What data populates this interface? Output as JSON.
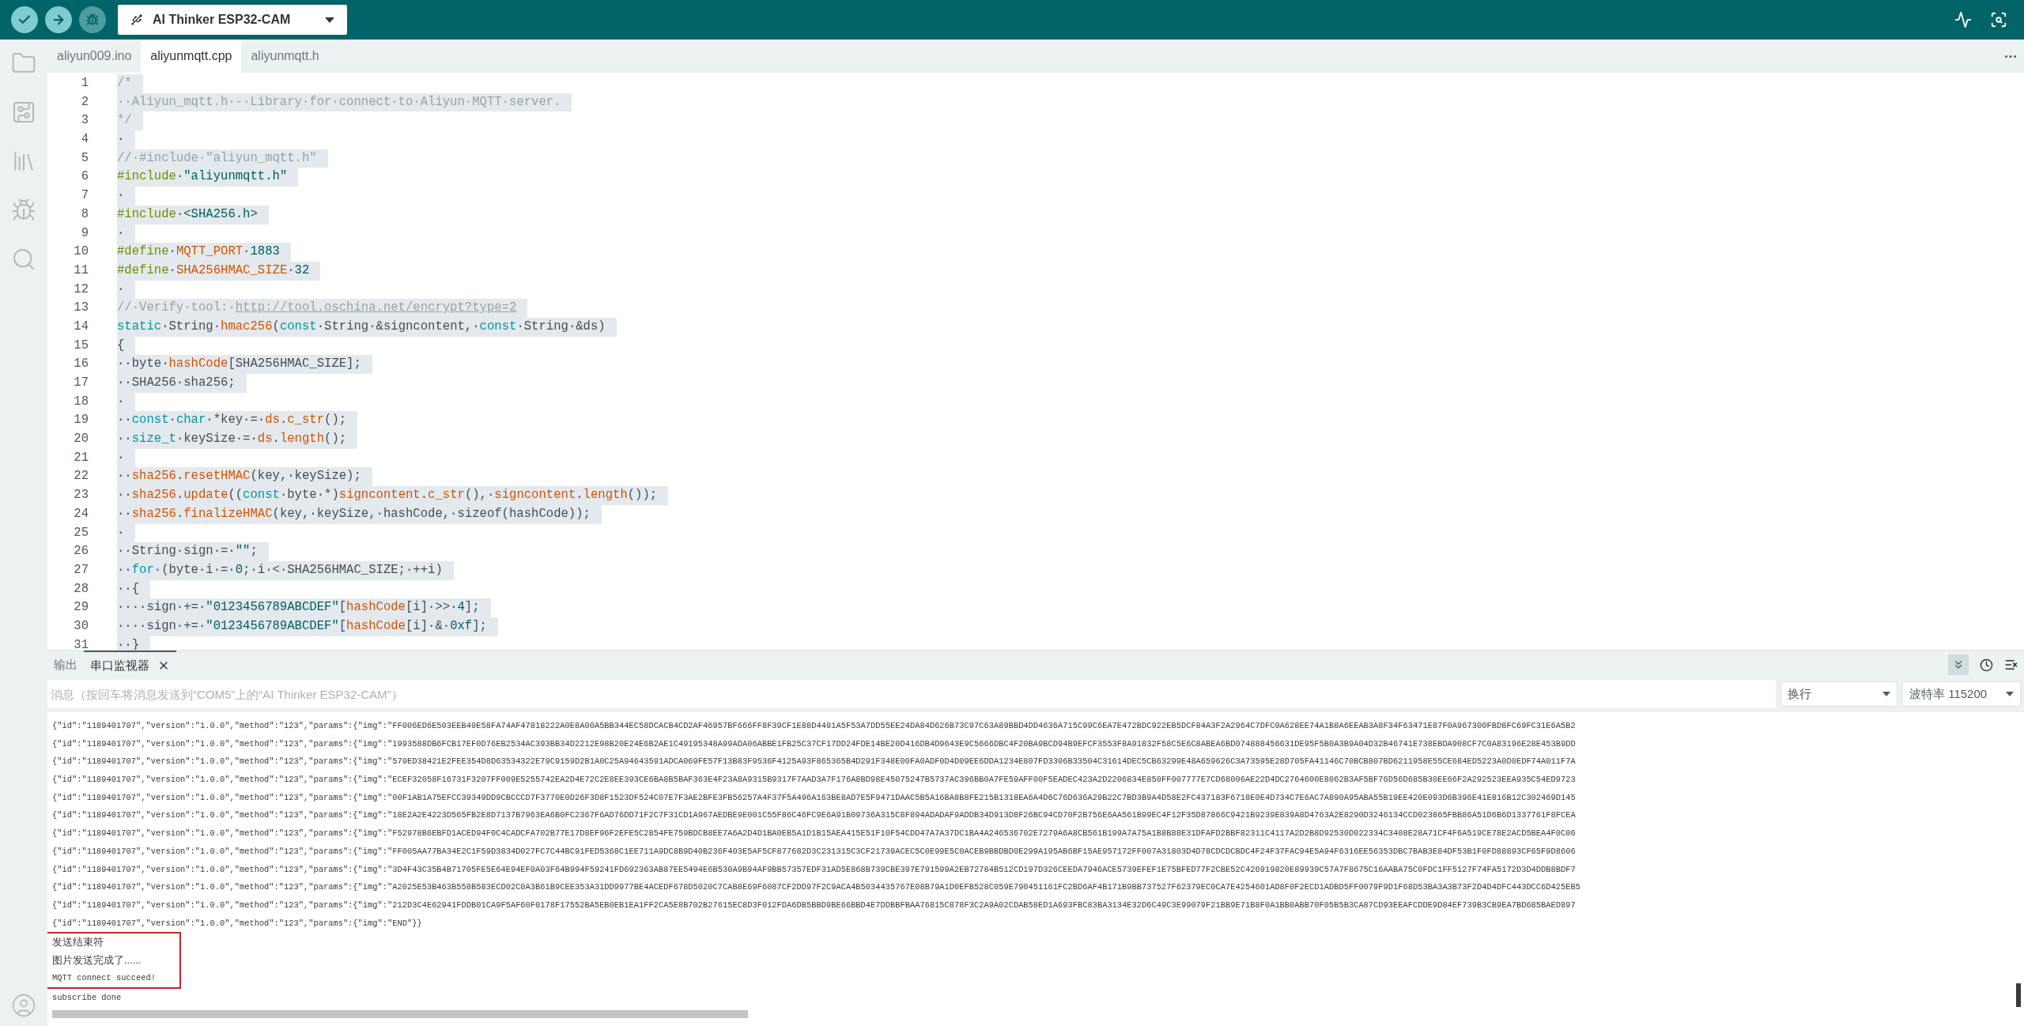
{
  "toolbar": {
    "board": "AI Thinker ESP32-CAM",
    "buttons": [
      {
        "kind": "verify",
        "disabled": false
      },
      {
        "kind": "upload",
        "disabled": false
      },
      {
        "kind": "debug",
        "disabled": true
      }
    ]
  },
  "tabs": [
    {
      "label": "aliyun009.ino",
      "selected": false
    },
    {
      "label": "aliyunmqtt.cpp",
      "selected": true
    },
    {
      "label": "aliyunmqtt.h",
      "selected": false
    }
  ],
  "editor": {
    "selected": true,
    "lines": [
      {
        "number": "1",
        "tokens": [
          {
            "kind": "comment",
            "text": "/*"
          }
        ]
      },
      {
        "number": "2",
        "tokens": [
          {
            "kind": "comment",
            "text": "··Aliyun_mqtt.h·-·Library·for·connect·to·Aliyun·MQTT·server."
          }
        ]
      },
      {
        "number": "3",
        "tokens": [
          {
            "kind": "comment",
            "text": "*/"
          }
        ]
      },
      {
        "number": "4",
        "tokens": [
          {
            "kind": "plain",
            "text": "·"
          }
        ]
      },
      {
        "number": "5",
        "tokens": [
          {
            "kind": "comment",
            "text": "//·#include·\"aliyun_mqtt.h\""
          }
        ]
      },
      {
        "number": "6",
        "tokens": [
          {
            "kind": "preproc",
            "text": "#include"
          },
          {
            "kind": "plain",
            "text": "·"
          },
          {
            "kind": "string",
            "text": "\"aliyunmqtt.h\""
          }
        ]
      },
      {
        "number": "7",
        "tokens": [
          {
            "kind": "plain",
            "text": "·"
          }
        ]
      },
      {
        "number": "8",
        "tokens": [
          {
            "kind": "preproc",
            "text": "#include"
          },
          {
            "kind": "plain",
            "text": "·"
          },
          {
            "kind": "string",
            "text": "<SHA256.h>"
          }
        ]
      },
      {
        "number": "9",
        "tokens": [
          {
            "kind": "plain",
            "text": "·"
          }
        ]
      },
      {
        "number": "10",
        "tokens": [
          {
            "kind": "preproc",
            "text": "#define"
          },
          {
            "kind": "plain",
            "text": "·"
          },
          {
            "kind": "macro",
            "text": "MQTT_PORT"
          },
          {
            "kind": "plain",
            "text": "·"
          },
          {
            "kind": "number",
            "text": "1883"
          }
        ]
      },
      {
        "number": "11",
        "tokens": [
          {
            "kind": "preproc",
            "text": "#define"
          },
          {
            "kind": "plain",
            "text": "·"
          },
          {
            "kind": "macro",
            "text": "SHA256HMAC_SIZE"
          },
          {
            "kind": "plain",
            "text": "·"
          },
          {
            "kind": "number",
            "text": "32"
          }
        ]
      },
      {
        "number": "12",
        "tokens": [
          {
            "kind": "plain",
            "text": "·"
          }
        ]
      },
      {
        "number": "13",
        "tokens": [
          {
            "kind": "comment",
            "text": "//·Verify·tool:·"
          },
          {
            "kind": "link",
            "text": "http://tool.oschina.net/encrypt?type=2"
          }
        ]
      },
      {
        "number": "14",
        "tokens": [
          {
            "kind": "keyword",
            "text": "static"
          },
          {
            "kind": "plain",
            "text": "·String·"
          },
          {
            "kind": "func",
            "text": "hmac256"
          },
          {
            "kind": "plain",
            "text": "("
          },
          {
            "kind": "keyword",
            "text": "const"
          },
          {
            "kind": "plain",
            "text": "·String·&signcontent,·"
          },
          {
            "kind": "keyword",
            "text": "const"
          },
          {
            "kind": "plain",
            "text": "·String·&ds)"
          }
        ]
      },
      {
        "number": "15",
        "tokens": [
          {
            "kind": "plain",
            "text": "{"
          }
        ]
      },
      {
        "number": "16",
        "tokens": [
          {
            "kind": "plain",
            "text": "··byte·"
          },
          {
            "kind": "func",
            "text": "hashCode"
          },
          {
            "kind": "plain",
            "text": "[SHA256HMAC_SIZE];"
          }
        ]
      },
      {
        "number": "17",
        "tokens": [
          {
            "kind": "plain",
            "text": "··SHA256·sha256;"
          }
        ]
      },
      {
        "number": "18",
        "tokens": [
          {
            "kind": "plain",
            "text": "·"
          }
        ]
      },
      {
        "number": "19",
        "tokens": [
          {
            "kind": "plain",
            "text": "··"
          },
          {
            "kind": "keyword",
            "text": "const"
          },
          {
            "kind": "plain",
            "text": "·"
          },
          {
            "kind": "keyword",
            "text": "char"
          },
          {
            "kind": "plain",
            "text": "·*key·=·"
          },
          {
            "kind": "func",
            "text": "ds"
          },
          {
            "kind": "plain",
            "text": "."
          },
          {
            "kind": "func",
            "text": "c_str"
          },
          {
            "kind": "plain",
            "text": "();"
          }
        ]
      },
      {
        "number": "20",
        "tokens": [
          {
            "kind": "plain",
            "text": "··"
          },
          {
            "kind": "keyword",
            "text": "size_t"
          },
          {
            "kind": "plain",
            "text": "·keySize·=·"
          },
          {
            "kind": "func",
            "text": "ds"
          },
          {
            "kind": "plain",
            "text": "."
          },
          {
            "kind": "func",
            "text": "length"
          },
          {
            "kind": "plain",
            "text": "();"
          }
        ]
      },
      {
        "number": "21",
        "tokens": [
          {
            "kind": "plain",
            "text": "·"
          }
        ]
      },
      {
        "number": "22",
        "tokens": [
          {
            "kind": "plain",
            "text": "··"
          },
          {
            "kind": "func",
            "text": "sha256"
          },
          {
            "kind": "plain",
            "text": "."
          },
          {
            "kind": "func",
            "text": "resetHMAC"
          },
          {
            "kind": "plain",
            "text": "(key,·keySize);"
          }
        ]
      },
      {
        "number": "23",
        "tokens": [
          {
            "kind": "plain",
            "text": "··"
          },
          {
            "kind": "func",
            "text": "sha256"
          },
          {
            "kind": "plain",
            "text": "."
          },
          {
            "kind": "func",
            "text": "update"
          },
          {
            "kind": "plain",
            "text": "(("
          },
          {
            "kind": "keyword",
            "text": "const"
          },
          {
            "kind": "plain",
            "text": "·byte·*)"
          },
          {
            "kind": "func",
            "text": "signcontent"
          },
          {
            "kind": "plain",
            "text": "."
          },
          {
            "kind": "func",
            "text": "c_str"
          },
          {
            "kind": "plain",
            "text": "(),·"
          },
          {
            "kind": "func",
            "text": "signcontent"
          },
          {
            "kind": "plain",
            "text": "."
          },
          {
            "kind": "func",
            "text": "length"
          },
          {
            "kind": "plain",
            "text": "());"
          }
        ]
      },
      {
        "number": "24",
        "tokens": [
          {
            "kind": "plain",
            "text": "··"
          },
          {
            "kind": "func",
            "text": "sha256"
          },
          {
            "kind": "plain",
            "text": "."
          },
          {
            "kind": "func",
            "text": "finalizeHMAC"
          },
          {
            "kind": "plain",
            "text": "(key,·keySize,·hashCode,·sizeof(hashCode));"
          }
        ]
      },
      {
        "number": "25",
        "tokens": [
          {
            "kind": "plain",
            "text": "·"
          }
        ]
      },
      {
        "number": "26",
        "tokens": [
          {
            "kind": "plain",
            "text": "··String·sign·=·"
          },
          {
            "kind": "string",
            "text": "\"\""
          },
          {
            "kind": "plain",
            "text": ";"
          }
        ]
      },
      {
        "number": "27",
        "tokens": [
          {
            "kind": "plain",
            "text": "··"
          },
          {
            "kind": "keyword",
            "text": "for"
          },
          {
            "kind": "plain",
            "text": "·(byte·i·=·"
          },
          {
            "kind": "number",
            "text": "0"
          },
          {
            "kind": "plain",
            "text": ";·i·<·SHA256HMAC_SIZE;·++i)"
          }
        ]
      },
      {
        "number": "28",
        "tokens": [
          {
            "kind": "plain",
            "text": "··{"
          }
        ]
      },
      {
        "number": "29",
        "tokens": [
          {
            "kind": "plain",
            "text": "····sign·+=·"
          },
          {
            "kind": "string",
            "text": "\"0123456789ABCDEF\""
          },
          {
            "kind": "plain",
            "text": "["
          },
          {
            "kind": "func",
            "text": "hashCode"
          },
          {
            "kind": "plain",
            "text": "[i]·>>·"
          },
          {
            "kind": "number",
            "text": "4"
          },
          {
            "kind": "plain",
            "text": "];"
          }
        ]
      },
      {
        "number": "30",
        "tokens": [
          {
            "kind": "plain",
            "text": "····sign·+=·"
          },
          {
            "kind": "string",
            "text": "\"0123456789ABCDEF\""
          },
          {
            "kind": "plain",
            "text": "["
          },
          {
            "kind": "func",
            "text": "hashCode"
          },
          {
            "kind": "plain",
            "text": "[i]·&·"
          },
          {
            "kind": "number",
            "text": "0xf"
          },
          {
            "kind": "plain",
            "text": "];"
          }
        ]
      },
      {
        "number": "31",
        "tokens": [
          {
            "kind": "plain",
            "text": "··}"
          }
        ]
      }
    ]
  },
  "bottom_panel": {
    "tabs": [
      {
        "label": "输出",
        "selected": false,
        "closable": false
      },
      {
        "label": "串口监视器",
        "selected": true,
        "closable": true
      }
    ],
    "autoscroll": true,
    "message_field": {
      "placeholder": "消息（按回车将消息发送到“COM5”上的“AI Thinker ESP32-CAM”）"
    },
    "line_ending": "换行",
    "baud_rate": "波特率 115200",
    "output": [
      {
        "text": "{\"id\":\"1189401707\",\"version\":\"1.0.0\",\"method\":\"123\",\"params\":{\"img\":\"FF006ED6E503EEB49E58FA74AF47818222A0E8A00A5BB344EC58DCACB4CD2AF46957BF666FF8F39CF1E88D4491A5F53A7DD55EE24DA84D626B73C97C63A89BBD4DD4636A715C99C6EA7E472BDC922EB5DCF84A3F2A2964C7DFC0A628EE74A1B8A6EEAB3A8F34F63471E87F0A967300FBD8FC69FC31E6A5B2",
        "boxed": false
      },
      {
        "text": "{\"id\":\"1189401707\",\"version\":\"1.0.0\",\"method\":\"123\",\"params\":{\"img\":\"1993588DB6FCB17EF0D76EB2534AC393BB34D2212E98B20E24E6B2AE1C49195348A99ADA06ABBE1FB25C37CF17DD24FDE14BE20D416DB4D9643E9C5666DBC4F20BA9BCD94B9EFCF3553F8A91832F58C5E6C8ABEA6BD074888456631DE95F5B0A3B9A04D32B46741E738EBDA908CF7C0A83196E28E453B9DD",
        "boxed": false
      },
      {
        "text": "{\"id\":\"1189401707\",\"version\":\"1.0.0\",\"method\":\"123\",\"params\":{\"img\":\"579ED38421E2FEE354D8D63534322E79C9159D2B1A0C25A94643591ADCA069FE57F13B83F9536F4125A93F865365B4D291F348E00FA0ADF0D4D09EE6DDA1234E807FD3306B33504C31614DEC5CB63299E48A659626C3A73595E28D705FA41146C70BCB807BD6211958E55CE684ED5223A0D0EDF74A011F7A",
        "boxed": false
      },
      {
        "text": "{\"id\":\"1189401707\",\"version\":\"1.0.0\",\"method\":\"123\",\"params\":{\"img\":\"ECEF32058F16731F3207FF009E5255742EA2D4E72C2E8EE393CE6BA8B5BAF363E4F23A8A9315B9317F7AAD3A7F176A8BD98E45075247B5737AC396BB0A7FE59AFF00F5EADEC423A2D2206834E850FF007777E7CD68006AE22D4DC2764600E8062B3AF5BF76D56D685B30EE66F2A292523EEA935C54ED9723",
        "boxed": false
      },
      {
        "text": "{\"id\":\"1189401707\",\"version\":\"1.0.0\",\"method\":\"123\",\"params\":{\"img\":\"00F1AB1A75EFCC39349DD9CBCCCD7F3770E0D26F3D8F1523DF524C07E7F3AE2BFE3FB56257A4F37F5A496A163BE8AD7E5F9471DAAC5B5A16BA8B8FE215B1318EA6A4D6C76D636A29B22C7BD3B9A4D58E2FC437183F6718E0E4D734C7E6AC7A890A95ABA55B19EE420E093D6B396E41E816B12C302469D145",
        "boxed": false
      },
      {
        "text": "{\"id\":\"1189401707\",\"version\":\"1.0.0\",\"method\":\"123\",\"params\":{\"img\":\"18E2A2E4223D565FB2E8D7137B7963EA6B0FC2367F6AD76DD71F2C7F31CD1A967AEDBE9E001C55F86C46FC9E6A91B09736A315C8F894ADADAF9ADDB34D913D8F26BC94CD70F2B756E6AA561B99EC4F12F35D87866C9421B9239E839A8D4763A2E8290D3246134CCD023865FBB86A51D6B6D1337761F8FCEA",
        "boxed": false
      },
      {
        "text": "{\"id\":\"1189401707\",\"version\":\"1.0.0\",\"method\":\"123\",\"params\":{\"img\":\"F52978B6EBFD1ACED94F0C4CADCFA702B77E17D8EF96F2EFE5C2854FE759BDCB8EE7A6A2D4D1BA0EB5A1D1B15AEA415E51F10F54CDD47A7A37DC1BA4A246536702E7279A6A8CB561B199A7A75A1B8B88E31DFAFD2BBF82311C4117A2D2B8D92530D022334C3408E28A71CF4F6A519CE78E2ACD5BEA4F0C06",
        "boxed": false
      },
      {
        "text": "{\"id\":\"1189401707\",\"version\":\"1.0.0\",\"method\":\"123\",\"params\":{\"img\":\"FF005AA77BA34E2C1F59D3834D027FC7C44BC91FED5368C1EE711A9DC8B9D40B236F403E5AF5CF877682D3C231315C3CF21739ACEC5C0E99E5C0ACEB9BBDBD0E299A195AB6BF15AE957172FF007A31803D4D78CDCDCBDC4F24F37FAC94E5A94F6316EE56353DBC7BAB3E84DF53B1F0FD88893CF65F9D8606",
        "boxed": false
      },
      {
        "text": "{\"id\":\"1189401707\",\"version\":\"1.0.0\",\"method\":\"123\",\"params\":{\"img\":\"3D4F43C35B4B71705FE5E64E94EF0A03F64B994F59241FD692363AB87EE5494E6B530A9B94AF9BB57357EDF31AD5E868B739CBE397E791599A2EB72784B512CD197D326CEEDA7946ACE5739EFEF1E75BFED77F2CBE52C426919820E89939C57A7F8675C16AABA75C0FDC1FF5127F74FA5172D3D4DDB8BDF7",
        "boxed": false
      },
      {
        "text": "{\"id\":\"1189401707\",\"version\":\"1.0.0\",\"method\":\"123\",\"params\":{\"img\":\"A2025E53B463B558B583ECD02C0A3B61B9CEE353A31DD9977BE4ACEDF678D5020C7CAB8E69F6087CF2DD97F2C9ACA4B5034435767E08B79A1D0EFB528C059E790451161FC2BD6AF4B171B9BB737527F62379EC0CA7E4254601AD8F0F2ECD1ADBD5FF0079F9D1F68D53BA3A3B73F2D4D4DFC443DCC6D425EB5",
        "boxed": false
      },
      {
        "text": "{\"id\":\"1189401707\",\"version\":\"1.0.0\",\"method\":\"123\",\"params\":{\"img\":\"212D3C4E62941FDDB01CA9F5AF60F0178F17552BA5EB0EB1EA1FF2CA5E8B702B27615EC8D3F012FDA6DB5BBD9BE66BBD4E7DDBBFBAA76815C878F3C2A9A02CDAB58ED1A693FBC83BA3134E32D6C49C3E99079F21BB9E71B8F0A1BB0ABB70F05B5B3CA87CD93EEAFCDDE9D84EF739B3CB9EA7BD685BAED897",
        "boxed": false
      },
      {
        "text": "{\"id\":\"1189401707\",\"version\":\"1.0.0\",\"method\":\"123\",\"params\":{\"img\":\"END\"}}",
        "boxed": false
      },
      {
        "text": "发送结束符",
        "boxed": true
      },
      {
        "text": "图片发送完成了......",
        "boxed": true
      },
      {
        "text": "MQTT connect succeed!",
        "boxed": true
      },
      {
        "text": "subscribe done",
        "boxed": false
      }
    ]
  }
}
